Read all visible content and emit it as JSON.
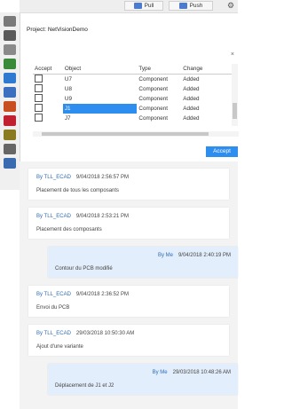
{
  "toolbar": {
    "pull_label": "Pull",
    "push_label": "Push"
  },
  "project": "Project: NetVisionDemo",
  "close_glyph": "×",
  "columns": [
    "Accept",
    "Object",
    "Type",
    "Change"
  ],
  "rows": [
    {
      "object": "U7",
      "type": "Component",
      "change": "Added",
      "selected": false
    },
    {
      "object": "U8",
      "type": "Component",
      "change": "Added",
      "selected": false
    },
    {
      "object": "U9",
      "type": "Component",
      "change": "Added",
      "selected": false
    },
    {
      "object": "J1",
      "type": "Component",
      "change": "Added",
      "selected": true
    },
    {
      "object": "J7",
      "type": "Component",
      "change": "Added",
      "selected": false
    }
  ],
  "accept_label": "Accept",
  "messages": [
    {
      "author": "By TLL_ECAD",
      "date": "9/04/2018 2:56:57 PM",
      "text": "Placement de tous les composants",
      "mine": false
    },
    {
      "author": "By TLL_ECAD",
      "date": "9/04/2018 2:53:21 PM",
      "text": "Placement des composants",
      "mine": false
    },
    {
      "author": "By Me",
      "date": "9/04/2018 2:40:19 PM",
      "text": "Contour du PCB modifié",
      "mine": true
    },
    {
      "author": "By TLL_ECAD",
      "date": "9/04/2018 2:36:52 PM",
      "text": "Envoi du PCB",
      "mine": false
    },
    {
      "author": "By TLL_ECAD",
      "date": "29/03/2018 10:50:30 AM",
      "text": "Ajout d'une variante",
      "mine": false
    },
    {
      "author": "By Me",
      "date": "29/03/2018 10:48:26 AM",
      "text": "Déplacement de J1 et J2",
      "mine": true
    }
  ],
  "left_icons": [
    "home-icon",
    "building-icon",
    "layers-icon",
    "image-icon",
    "globe-icon",
    "list-icon",
    "pie-icon",
    "grid-icon",
    "chart-icon",
    "settings-icon",
    "pcb-icon"
  ],
  "colors": {
    "accent": "#2d8ef0",
    "link": "#2e6db8",
    "feed_bg": "#f3f3f3",
    "mine_bg": "#e2eefb"
  }
}
